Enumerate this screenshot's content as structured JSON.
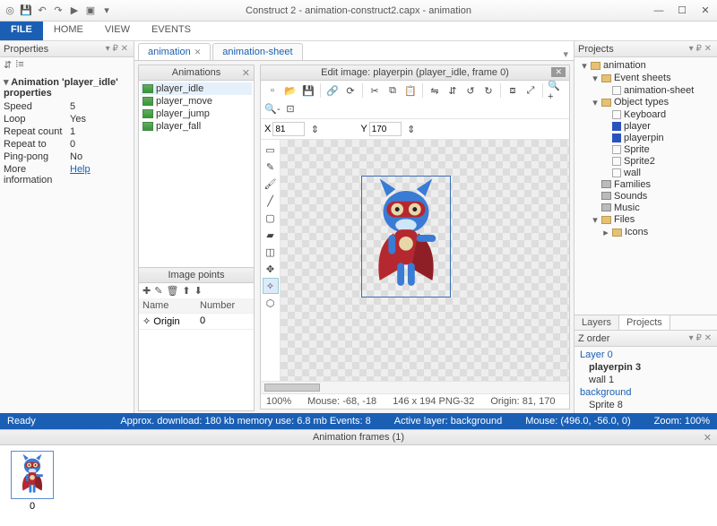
{
  "titlebar": {
    "title": "Construct 2 - animation-construct2.capx - animation"
  },
  "ribbon": {
    "file": "FILE",
    "tabs": [
      "HOME",
      "VIEW",
      "EVENTS"
    ]
  },
  "properties": {
    "title": "Properties",
    "group": "Animation 'player_idle' properties",
    "rows": [
      {
        "name": "Speed",
        "value": "5"
      },
      {
        "name": "Loop",
        "value": "Yes"
      },
      {
        "name": "Repeat count",
        "value": "1"
      },
      {
        "name": "Repeat to",
        "value": "0"
      },
      {
        "name": "Ping-pong",
        "value": "No"
      }
    ],
    "more_label": "More information",
    "more_value": "Help"
  },
  "doctabs": {
    "items": [
      {
        "label": "animation",
        "active": true,
        "closable": true
      },
      {
        "label": "animation-sheet",
        "active": false,
        "closable": false
      }
    ]
  },
  "animpanel": {
    "title": "Animations",
    "items": [
      "player_idle",
      "player_move",
      "player_jump",
      "player_fall"
    ]
  },
  "imagepoints": {
    "title": "Image points",
    "cols": [
      "Name",
      "Number"
    ],
    "rows": [
      {
        "name": "Origin",
        "number": "0"
      }
    ]
  },
  "editor": {
    "title": "Edit image: playerpin (player_idle, frame 0)",
    "x_label": "X",
    "x_value": "81",
    "y_label": "Y",
    "y_value": "170",
    "status": {
      "zoom": "100%",
      "mouse": "Mouse: -68, -18",
      "dim": "146 x 194  PNG-32",
      "origin": "Origin: 81, 170"
    }
  },
  "projects": {
    "title": "Projects",
    "tabs": [
      "Layers",
      "Projects"
    ],
    "tree": [
      {
        "d": 0,
        "tw": "▾",
        "icon": "folder",
        "label": "animation"
      },
      {
        "d": 1,
        "tw": "▾",
        "icon": "folder",
        "label": "Event sheets"
      },
      {
        "d": 2,
        "tw": "",
        "icon": "sheet",
        "label": "animation-sheet"
      },
      {
        "d": 1,
        "tw": "▾",
        "icon": "folder",
        "label": "Object types"
      },
      {
        "d": 2,
        "tw": "",
        "icon": "kb",
        "label": "Keyboard"
      },
      {
        "d": 2,
        "tw": "",
        "icon": "blue",
        "label": "player"
      },
      {
        "d": 2,
        "tw": "",
        "icon": "blue",
        "label": "playerpin"
      },
      {
        "d": 2,
        "tw": "",
        "icon": "box",
        "label": "Sprite"
      },
      {
        "d": 2,
        "tw": "",
        "icon": "box",
        "label": "Sprite2"
      },
      {
        "d": 2,
        "tw": "",
        "icon": "box",
        "label": "wall"
      },
      {
        "d": 1,
        "tw": "",
        "icon": "folder-gray",
        "label": "Families"
      },
      {
        "d": 1,
        "tw": "",
        "icon": "folder-gray",
        "label": "Sounds"
      },
      {
        "d": 1,
        "tw": "",
        "icon": "folder-gray",
        "label": "Music"
      },
      {
        "d": 1,
        "tw": "▾",
        "icon": "folder",
        "label": "Files"
      },
      {
        "d": 2,
        "tw": "▸",
        "icon": "folder",
        "label": "Icons"
      }
    ]
  },
  "zorder": {
    "title": "Z order",
    "sections": [
      {
        "name": "Layer 0",
        "items": [
          {
            "label": "playerpin 3",
            "bold": true
          },
          {
            "label": "wall 1"
          }
        ]
      },
      {
        "name": "background",
        "items": [
          {
            "label": "Sprite 8"
          }
        ]
      }
    ]
  },
  "statusbar": {
    "ready": "Ready",
    "approx": "Approx. download: 180 kb   memory use: 6.8 mb   Events: 8",
    "active": "Active layer: background",
    "mouse": "Mouse: (496.0, -56.0, 0)",
    "zoom": "Zoom: 100%"
  },
  "frames": {
    "title": "Animation frames (1)",
    "items": [
      {
        "index": "0"
      }
    ]
  }
}
